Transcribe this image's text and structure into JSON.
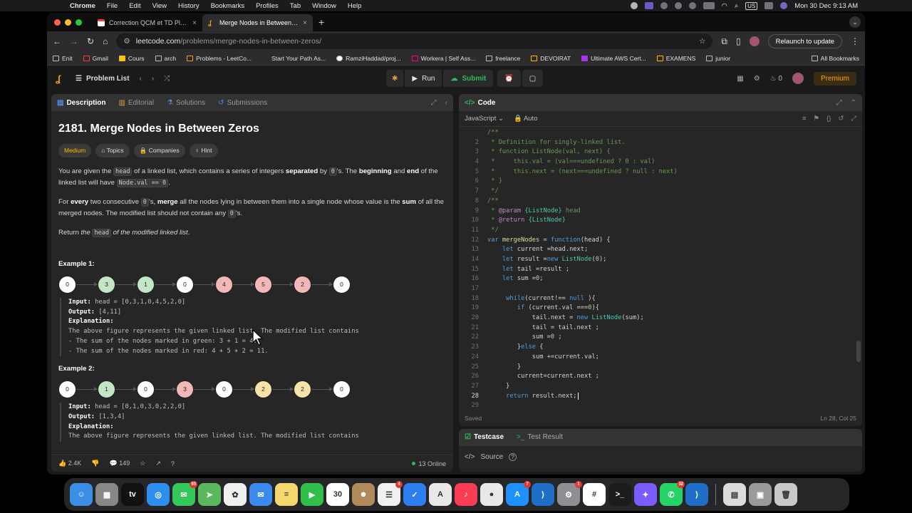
{
  "menubar": {
    "app": "Chrome",
    "items": [
      "File",
      "Edit",
      "View",
      "History",
      "Bookmarks",
      "Profiles",
      "Tab",
      "Window",
      "Help"
    ],
    "datetime": "Mon 30 Dec  9:13 AM",
    "input_source": "US"
  },
  "browser": {
    "tabs": [
      {
        "title": "Correction QCM et TD Planni",
        "favicon": "gmail-icon",
        "active": false
      },
      {
        "title": "Merge Nodes in Between Zer",
        "favicon": "leetcode-icon",
        "active": true
      }
    ],
    "url_host": "leetcode.com",
    "url_path": "/problems/merge-nodes-in-between-zeros/",
    "relaunch_label": "Relaunch to update",
    "bookmarks": [
      "Enit",
      "Gmail",
      "Cours",
      "arch",
      "Problems - LeetCo...",
      "Start Your Path As...",
      "RamziHaddad/proj...",
      "Workera | Self Ass...",
      "freelance",
      "DEVOIRAT",
      "Ultimate AWS Cert...",
      "EXAMENS",
      "junior"
    ],
    "all_bookmarks": "All Bookmarks"
  },
  "lcnav": {
    "problem_list": "Problem List",
    "run": "Run",
    "submit": "Submit",
    "streak": "0",
    "premium": "Premium"
  },
  "left": {
    "tabs": [
      "Description",
      "Editorial",
      "Solutions",
      "Submissions"
    ],
    "title": "2181. Merge Nodes in Between Zeros",
    "difficulty": "Medium",
    "tags": [
      "Topics",
      "Companies",
      "Hint"
    ],
    "p1": {
      "a": "You are given the ",
      "code1": "head",
      "b": " of a linked list, which contains a series of integers ",
      "bold1": "separated",
      "c": " by ",
      "code2": "0",
      "d": "'s. The ",
      "bold2": "beginning",
      "e": " and ",
      "bold3": "end",
      "f": " of the linked list will have ",
      "code3": "Node.val == 0",
      "g": "."
    },
    "p2": {
      "a": "For ",
      "bold1": "every",
      "b": " two consecutive ",
      "code1": "0",
      "c": "'s, ",
      "bold2": "merge",
      "d": " all the nodes lying in between them into a single node whose value is the ",
      "bold3": "sum",
      "e": " of all the merged nodes. The modified list should not contain any ",
      "code2": "0",
      "f": "'s."
    },
    "p3": {
      "a": "Return ",
      "em1": "the ",
      "code1": "head",
      "em2": " of the modified linked list",
      "b": "."
    },
    "example1": {
      "heading": "Example 1:",
      "nodes": [
        {
          "v": "0",
          "c": "white"
        },
        {
          "v": "3",
          "c": "green"
        },
        {
          "v": "1",
          "c": "green"
        },
        {
          "v": "0",
          "c": "white"
        },
        {
          "v": "4",
          "c": "red"
        },
        {
          "v": "5",
          "c": "red"
        },
        {
          "v": "2",
          "c": "red"
        },
        {
          "v": "0",
          "c": "white"
        }
      ],
      "input_label": "Input:",
      "input": " head = [0,3,1,0,4,5,2,0]",
      "output_label": "Output:",
      "output": " [4,11]",
      "expl_label": "Explanation:",
      "lines": [
        "The above figure represents the given linked list. The modified list contains",
        "- The sum of the nodes marked in green: 3 + 1 = 4.",
        "- The sum of the nodes marked in red: 4 + 5 + 2 = 11."
      ]
    },
    "example2": {
      "heading": "Example 2:",
      "nodes": [
        {
          "v": "0",
          "c": "white"
        },
        {
          "v": "1",
          "c": "green"
        },
        {
          "v": "0",
          "c": "white"
        },
        {
          "v": "3",
          "c": "red"
        },
        {
          "v": "0",
          "c": "white"
        },
        {
          "v": "2",
          "c": "yellow"
        },
        {
          "v": "2",
          "c": "yellow"
        },
        {
          "v": "0",
          "c": "white"
        }
      ],
      "input_label": "Input:",
      "input": " head = [0,1,0,3,0,2,2,0]",
      "output_label": "Output:",
      "output": " [1,3,4]",
      "expl_label": "Explanation:",
      "lines": [
        "The above figure represents the given linked list. The modified list contains"
      ]
    },
    "footer": {
      "likes": "2.4K",
      "comments": "149",
      "online": "13 Online"
    }
  },
  "code": {
    "title": "Code",
    "language": "JavaScript",
    "mode": "Auto",
    "status": "Saved",
    "cursor": "Ln 28, Col 25",
    "current_line": 28,
    "lines": [
      {
        "n": "",
        "t": "/**"
      },
      {
        "n": "2",
        "t": " * Definition for singly-linked list."
      },
      {
        "n": "3",
        "t": " * function ListNode(val, next) {"
      },
      {
        "n": "4",
        "t": " *     this.val = (val===undefined ? 0 : val)"
      },
      {
        "n": "5",
        "t": " *     this.next = (next===undefined ? null : next)"
      },
      {
        "n": "6",
        "t": " * }"
      },
      {
        "n": "7",
        "t": " */"
      },
      {
        "n": "8",
        "t": "/**"
      },
      {
        "n": "9",
        "t": " * @param {ListNode} head"
      },
      {
        "n": "10",
        "t": " * @return {ListNode}"
      },
      {
        "n": "11",
        "t": " */"
      },
      {
        "n": "12",
        "t": "var mergeNodes = function(head) {"
      },
      {
        "n": "13",
        "t": "    let current =head.next;"
      },
      {
        "n": "14",
        "t": "    let result =new ListNode(0);"
      },
      {
        "n": "15",
        "t": "    let tail =result ;"
      },
      {
        "n": "16",
        "t": "    let sum =0;"
      },
      {
        "n": "17",
        "t": ""
      },
      {
        "n": "18",
        "t": "     while(current!== null ){"
      },
      {
        "n": "19",
        "t": "        if (current.val ===0){"
      },
      {
        "n": "20",
        "t": "            tail.next = new ListNode(sum);"
      },
      {
        "n": "21",
        "t": "            tail = tail.next ;"
      },
      {
        "n": "22",
        "t": "            sum =0 ;"
      },
      {
        "n": "23",
        "t": "        }else {"
      },
      {
        "n": "24",
        "t": "            sum +=current.val;"
      },
      {
        "n": "25",
        "t": "        }"
      },
      {
        "n": "26",
        "t": "        current=current.next ;"
      },
      {
        "n": "27",
        "t": "     }"
      },
      {
        "n": "28",
        "t": "     return result.next;"
      },
      {
        "n": "29",
        "t": ""
      }
    ]
  },
  "testcase": {
    "tab1": "Testcase",
    "tab2": "Test Result",
    "source": "Source"
  },
  "dock": {
    "apps": [
      {
        "name": "finder-icon",
        "bg": "#3a8ee6",
        "g": "☺"
      },
      {
        "name": "launchpad-icon",
        "bg": "#888",
        "g": "▦"
      },
      {
        "name": "apple-tv-icon",
        "bg": "#111",
        "g": "tv"
      },
      {
        "name": "safari-icon",
        "bg": "#2d8ef0",
        "g": "◎"
      },
      {
        "name": "messages-icon",
        "bg": "#34c759",
        "g": "✉",
        "badge": "93"
      },
      {
        "name": "maps-icon",
        "bg": "#5cb85c",
        "g": "➤"
      },
      {
        "name": "photos-icon",
        "bg": "#f0f0f0",
        "g": "✿"
      },
      {
        "name": "mail-icon",
        "bg": "#3b8af0",
        "g": "✉"
      },
      {
        "name": "notes-icon",
        "bg": "#f5d76e",
        "g": "≡"
      },
      {
        "name": "facetime-icon",
        "bg": "#2fbf4a",
        "g": "▶"
      },
      {
        "name": "calendar-icon",
        "bg": "#ffffff",
        "g": "30"
      },
      {
        "name": "contacts-icon",
        "bg": "#b08a5a",
        "g": "☻"
      },
      {
        "name": "reminders-icon",
        "bg": "#f0f0f0",
        "g": "☰",
        "badge": "4"
      },
      {
        "name": "tasks-icon",
        "bg": "#2d7ff0",
        "g": "✓"
      },
      {
        "name": "instruments-icon",
        "bg": "#e8e8e8",
        "g": "A"
      },
      {
        "name": "music-icon",
        "bg": "#fa3c55",
        "g": "♪"
      },
      {
        "name": "chrome-icon",
        "bg": "#e8e8e8",
        "g": "●"
      },
      {
        "name": "app-store-icon",
        "bg": "#1e90ff",
        "g": "A",
        "badge": "7"
      },
      {
        "name": "vscode-icon",
        "bg": "#1f6fc8",
        "g": "⟩"
      },
      {
        "name": "settings-icon",
        "bg": "#8e8e93",
        "g": "⚙",
        "badge": "1"
      },
      {
        "name": "slack-icon",
        "bg": "#ffffff",
        "g": "#"
      },
      {
        "name": "terminal-icon",
        "bg": "#1c1c1c",
        "g": ">_"
      },
      {
        "name": "messenger-icon",
        "bg": "#7b5cff",
        "g": "✦"
      },
      {
        "name": "whatsapp-icon",
        "bg": "#25d366",
        "g": "✆",
        "badge": "32"
      },
      {
        "name": "vscode-alt-icon",
        "bg": "#1f6fc8",
        "g": "⟩"
      },
      {
        "name": "documents-icon",
        "bg": "#dcdcdc",
        "g": "▤"
      },
      {
        "name": "preview-icon",
        "bg": "#9a9a9a",
        "g": "▣"
      },
      {
        "name": "trash-icon",
        "bg": "#c9c9c9",
        "g": "🗑"
      }
    ]
  }
}
